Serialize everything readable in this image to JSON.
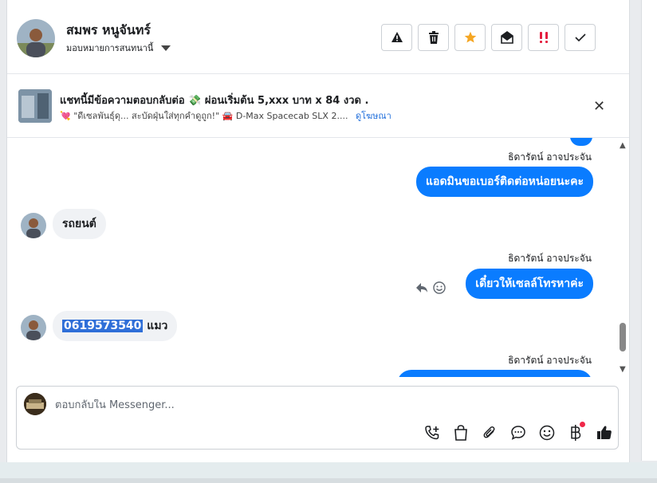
{
  "header": {
    "contact_name": "สมพร หนูจันทร์",
    "assign_label": "มอบหมายการสนทนานี้",
    "actions": [
      "mark-spam",
      "delete",
      "star",
      "mark-unread",
      "follow-up",
      "mark-done"
    ]
  },
  "ad": {
    "title": "แชทนี้มีข้อความตอบกลับต่อ 💸 ผ่อนเริ่มต้น 5,xxx บาท x 84 งวด .",
    "subtitle": "💘 \"ดีเซลพันธุ์ดุ... สะบัดฝุ่นใส่ทุกคำดูถูก!\" 🚘 D-Max Spacecab SLX 2....",
    "link": "ดูโฆษณา",
    "close": "✕"
  },
  "messages": {
    "m1_sender": "ธิดารัตน์ อาจประจัน",
    "m1_text": "แอดมินขอเบอร์ติดต่อหน่อยนะคะ",
    "m2_text": "รถยนต์",
    "m3_sender": "ธิดารัตน์ อาจประจัน",
    "m3_text": "เดี๋ยวให้เซลล์โทรหาค่ะ",
    "m4_phone": "0619573540",
    "m4_rest": " แมว",
    "m5_sender": "ธิดารัตน์ อาจประจัน"
  },
  "composer": {
    "placeholder": "ตอบกลับใน Messenger..."
  },
  "colors": {
    "accent": "#0a7cff",
    "star": "#f5a623",
    "follow_up": "#e41e3f"
  }
}
